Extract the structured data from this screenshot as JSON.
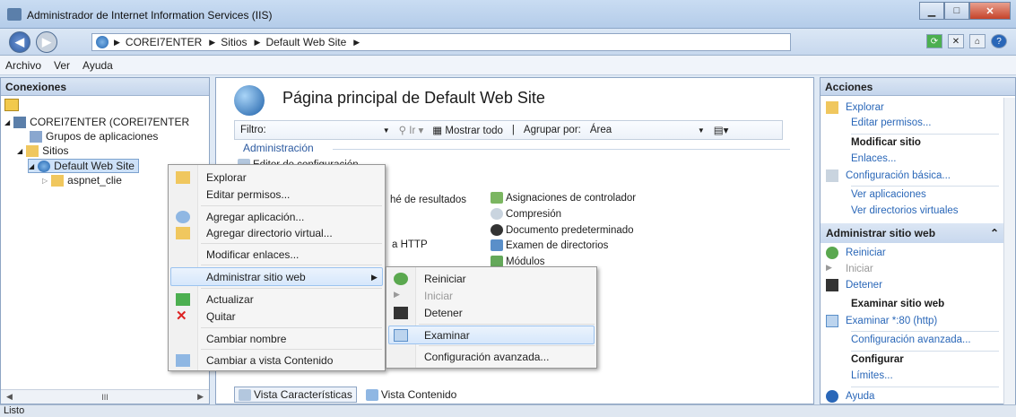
{
  "window": {
    "title": "Administrador de Internet Information Services (IIS)"
  },
  "address": {
    "crumbs": [
      "COREI7ENTER",
      "Sitios",
      "Default Web Site"
    ]
  },
  "menubar": [
    "Archivo",
    "Ver",
    "Ayuda"
  ],
  "connections": {
    "title": "Conexiones",
    "tree": [
      "COREI7ENTER (COREI7ENTER",
      "Grupos de aplicaciones",
      "Sitios",
      "Default Web Site",
      "aspnet_clie"
    ],
    "scroll_glyph": "III"
  },
  "center": {
    "title": "Página principal de Default Web Site",
    "filter": {
      "label": "Filtro:",
      "go": "Ir",
      "show_all": "Mostrar todo",
      "group_by_label": "Agrupar por:",
      "group_by_value": "Área"
    },
    "section": "Administración",
    "features": {
      "editor": "Editor de configuración",
      "cache": "hé de resultados",
      "http": "a HTTP",
      "handlers": "Asignaciones de controlador",
      "compression": "Compresión",
      "default_doc": "Documento predeterminado",
      "dir_browse": "Examen de directorios",
      "modules": "Módulos"
    },
    "tabs": {
      "features": "Vista Características",
      "content": "Vista Contenido"
    }
  },
  "actions": {
    "title": "Acciones",
    "explore": "Explorar",
    "edit_perms": "Editar permisos...",
    "modify_site": "Modificar sitio",
    "bindings": "Enlaces...",
    "basic_settings": "Configuración básica...",
    "view_apps": "Ver aplicaciones",
    "view_vdirs": "Ver directorios virtuales",
    "manage_site": "Administrar sitio web",
    "restart": "Reiniciar",
    "start": "Iniciar",
    "stop": "Detener",
    "browse_site": "Examinar sitio web",
    "browse_80": "Examinar *:80 (http)",
    "advanced": "Configuración avanzada...",
    "configure": "Configurar",
    "limits": "Límites...",
    "help": "Ayuda"
  },
  "context_menu": {
    "explore": "Explorar",
    "edit_perms": "Editar permisos...",
    "add_app": "Agregar aplicación...",
    "add_vdir": "Agregar directorio virtual...",
    "edit_bindings": "Modificar enlaces...",
    "manage_site": "Administrar sitio web",
    "refresh": "Actualizar",
    "remove": "Quitar",
    "rename": "Cambiar nombre",
    "switch_content": "Cambiar a vista Contenido"
  },
  "submenu": {
    "restart": "Reiniciar",
    "start": "Iniciar",
    "stop": "Detener",
    "browse": "Examinar",
    "advanced": "Configuración avanzada..."
  },
  "status": "Listo"
}
